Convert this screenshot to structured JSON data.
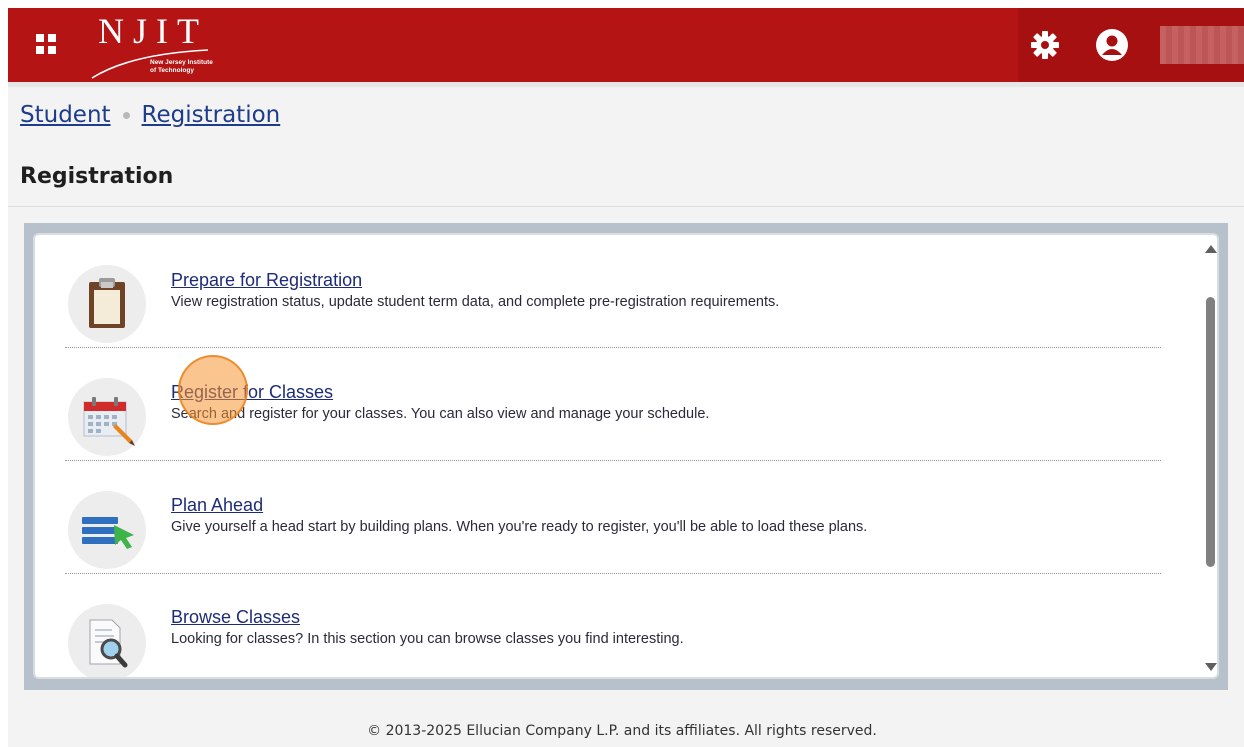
{
  "header": {
    "logo_letters": "NJIT",
    "logo_line1": "New Jersey Institute",
    "logo_line2": "of Technology",
    "user_name": ""
  },
  "breadcrumb": {
    "items": [
      "Student",
      "Registration"
    ]
  },
  "page_title": "Registration",
  "items": [
    {
      "title": "Prepare for Registration",
      "desc": "View registration status, update student term data, and complete pre-registration requirements.",
      "icon": "clipboard-icon"
    },
    {
      "title": "Register for Classes",
      "desc": "Search and register for your classes. You can also view and manage your schedule.",
      "icon": "calendar-pencil-icon"
    },
    {
      "title": "Plan Ahead",
      "desc": "Give yourself a head start by building plans. When you're ready to register, you'll be able to load these plans.",
      "icon": "plan-list-arrow-icon"
    },
    {
      "title": "Browse Classes",
      "desc": "Looking for classes? In this section you can browse classes you find interesting.",
      "icon": "document-magnifier-icon"
    }
  ],
  "footer": "© 2013-2025 Ellucian Company L.P. and its affiliates. All rights reserved.",
  "colors": {
    "header_red": "#b51414",
    "link_blue": "#1e2c78",
    "panel_frame": "#b6c1cc"
  }
}
